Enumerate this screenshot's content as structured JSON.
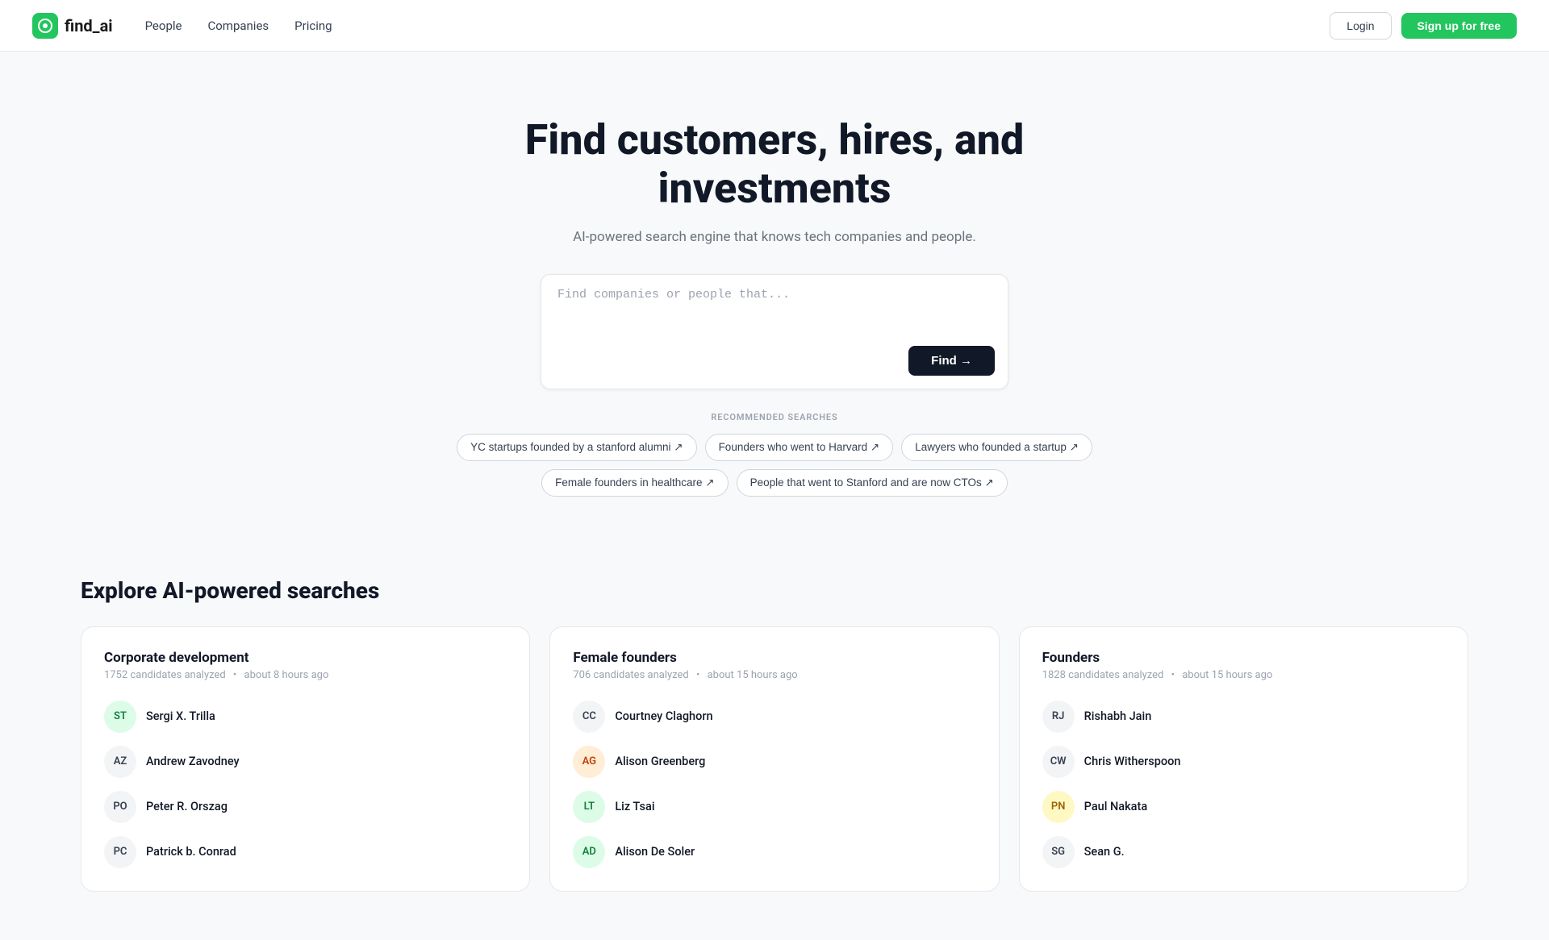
{
  "logo": {
    "text": "find_ai",
    "icon_alt": "find-ai-logo"
  },
  "nav": {
    "links": [
      {
        "id": "people",
        "label": "People"
      },
      {
        "id": "companies",
        "label": "Companies"
      },
      {
        "id": "pricing",
        "label": "Pricing"
      }
    ],
    "login_label": "Login",
    "signup_label": "Sign up for free"
  },
  "hero": {
    "title": "Find customers, hires, and investments",
    "subtitle": "AI-powered search engine that knows tech companies and people.",
    "search_placeholder": "Find companies or people that...",
    "find_button_label": "Find →"
  },
  "recommended": {
    "section_label": "RECOMMENDED SEARCHES",
    "chips": [
      {
        "id": "chip-1",
        "label": "YC startups founded by a stanford alumni ↗"
      },
      {
        "id": "chip-2",
        "label": "Founders who went to Harvard ↗"
      },
      {
        "id": "chip-3",
        "label": "Lawyers who founded a startup ↗"
      },
      {
        "id": "chip-4",
        "label": "Female founders in healthcare ↗"
      },
      {
        "id": "chip-5",
        "label": "People that went to Stanford and are now CTOs ↗"
      }
    ]
  },
  "explore": {
    "section_title": "Explore AI-powered searches",
    "cards": [
      {
        "id": "card-corporate",
        "title": "Corporate development",
        "candidates": "1752 candidates analyzed",
        "time": "about 8 hours ago",
        "people": [
          {
            "name": "Sergi X. Trilla",
            "av_class": "av-green",
            "initials": "ST"
          },
          {
            "name": "Andrew Zavodney",
            "av_class": "av-gray",
            "initials": "AZ"
          },
          {
            "name": "Peter R. Orszag",
            "av_class": "av-gray",
            "initials": "PO"
          },
          {
            "name": "Patrick b. Conrad",
            "av_class": "av-gray",
            "initials": "PC"
          }
        ]
      },
      {
        "id": "card-female",
        "title": "Female founders",
        "candidates": "706 candidates analyzed",
        "time": "about 15 hours ago",
        "people": [
          {
            "name": "Courtney Claghorn",
            "av_class": "av-gray",
            "initials": "CC"
          },
          {
            "name": "Alison Greenberg",
            "av_class": "av-orange",
            "initials": "AG"
          },
          {
            "name": "Liz Tsai",
            "av_class": "av-green",
            "initials": "LT"
          },
          {
            "name": "Alison De Soler",
            "av_class": "av-green",
            "initials": "AD"
          }
        ]
      },
      {
        "id": "card-founders",
        "title": "Founders",
        "candidates": "1828 candidates analyzed",
        "time": "about 15 hours ago",
        "people": [
          {
            "name": "Rishabh Jain",
            "av_class": "av-gray",
            "initials": "RJ"
          },
          {
            "name": "Chris Witherspoon",
            "av_class": "av-gray",
            "initials": "CW"
          },
          {
            "name": "Paul Nakata",
            "av_class": "av-yellow",
            "initials": "PN"
          },
          {
            "name": "Sean G.",
            "av_class": "av-gray",
            "initials": "SG"
          }
        ]
      }
    ]
  }
}
